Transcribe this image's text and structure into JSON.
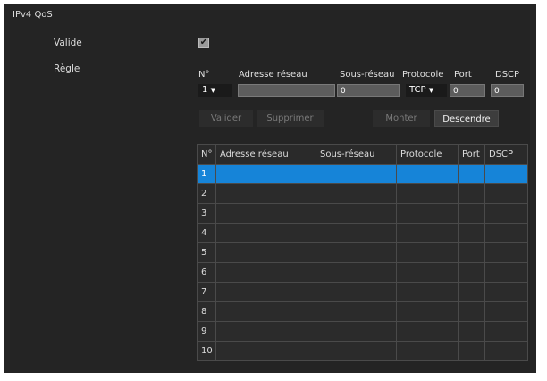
{
  "section_title": "IPv4 QoS",
  "valide": {
    "label": "Valide",
    "checked": true,
    "check_glyph": "✔"
  },
  "regle": {
    "label": "Règle"
  },
  "form": {
    "headers": {
      "no": "N°",
      "adresse": "Adresse réseau",
      "sous_reseau": "Sous-réseau",
      "protocole": "Protocole",
      "port": "Port",
      "dscp": "DSCP"
    },
    "no_value": "1",
    "adresse_value": "",
    "sous_reseau_value": "0",
    "protocole_value": "TCP",
    "port_value": "0",
    "dscp_value": "0",
    "dropdown_glyph": "▼"
  },
  "buttons": {
    "valider": "Valider",
    "supprimer": "Supprimer",
    "monter": "Monter",
    "descendre": "Descendre"
  },
  "table": {
    "columns": [
      "N°",
      "Adresse réseau",
      "Sous-réseau",
      "Protocole",
      "Port",
      "DSCP"
    ],
    "rows": [
      "1",
      "2",
      "3",
      "4",
      "5",
      "6",
      "7",
      "8",
      "9",
      "10"
    ],
    "selected_row": "1"
  },
  "colors": {
    "panel": "#242424",
    "selection": "#1684d8"
  }
}
